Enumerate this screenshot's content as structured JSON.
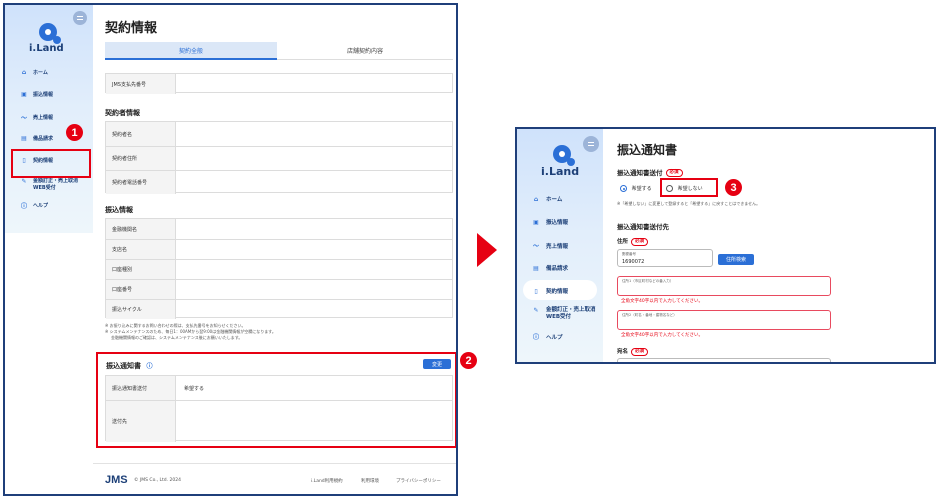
{
  "left_screen": {
    "sidebar": {
      "logo": "i.Land",
      "items": [
        {
          "icon": "home-icon",
          "label": "ホーム"
        },
        {
          "icon": "bank-transfer-icon",
          "label": "振込情報"
        },
        {
          "icon": "chart-line-icon",
          "label": "売上情報"
        },
        {
          "icon": "invoice-icon",
          "label": "備品請求"
        },
        {
          "icon": "document-icon",
          "label": "契約情報"
        },
        {
          "icon": "pencil-icon",
          "label": "金額訂正・売上取消"
        },
        {
          "icon": "help-icon",
          "label": "ヘルプ"
        }
      ],
      "item6_line2": "WEB受付",
      "highlight_badge": "1"
    },
    "main": {
      "title": "契約情報",
      "tabs": [
        "契約全般",
        "店舗契約内容"
      ],
      "jms_row_label": "JMS支払先番号",
      "contractor_heading": "契約者情報",
      "contractor_rows": [
        "契約者名",
        "契約者住所",
        "契約者電話番号"
      ],
      "transfer_heading": "振込情報",
      "transfer_rows": [
        "金融機関名",
        "支店名",
        "口座種別",
        "口座番号",
        "振込サイクル"
      ],
      "notes": [
        "※ お振り込みに関するお問い合わせの際は、支払先番号をお知らせください。",
        "※ システムメンテナンスのため、毎日1：00AMから翌9:00は金融機関情報が空欄になります。",
        "金融機関情報のご確認は、システムメンテナンス後にお願いいたします。"
      ],
      "notice_section": {
        "title": "振込通知書",
        "help_icon": "help-circle-icon",
        "change_button": "変更",
        "rows": [
          {
            "label": "振込通知書送付",
            "value": "希望する"
          },
          {
            "label": "送付先",
            "value": ""
          }
        ],
        "badge": "2"
      },
      "footer": {
        "brand": "JMS",
        "copyright": "© JMS Co., Ltd. 2024",
        "links": [
          "i.Land利用規約",
          "利用環境",
          "プライバシーポリシー"
        ]
      }
    }
  },
  "right_screen": {
    "sidebar": {
      "logo": "i.Land",
      "items": [
        {
          "icon": "home-icon",
          "label": "ホーム"
        },
        {
          "icon": "bank-transfer-icon",
          "label": "振込情報"
        },
        {
          "icon": "chart-line-icon",
          "label": "売上情報"
        },
        {
          "icon": "invoice-icon",
          "label": "備品請求"
        },
        {
          "icon": "document-icon",
          "label": "契約情報"
        },
        {
          "icon": "pencil-icon",
          "label": "金額訂正・売上取消"
        },
        {
          "icon": "help-icon",
          "label": "ヘルプ"
        }
      ],
      "item6_line2": "WEB受付"
    },
    "main": {
      "title": "振込通知書",
      "send_label": "振込通知書送付",
      "required": "必須",
      "radio_options": [
        "希望する",
        "希望しない"
      ],
      "radio_note": "※「希望しない」に変更して登録すると「希望する」に戻すことはできません。",
      "badge": "3",
      "destination_heading": "振込通知書送付先",
      "address_label": "住所",
      "postal_caption": "郵便番号",
      "postal_value": "1690072",
      "address_search_button": "住所検索",
      "address1_caption": "住所1（市区町村などの番入力）",
      "address2_caption": "住所2（町名・番地・建物名など）",
      "error_text": "全角文字40字以内で入力してください。",
      "name_label": "宛名"
    }
  },
  "colors": {
    "accent": "#2b6fd6",
    "highlight": "#e60012",
    "frame": "#1f3f7a"
  }
}
